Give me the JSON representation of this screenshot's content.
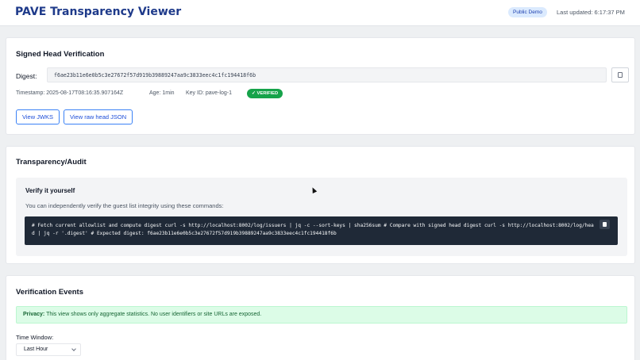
{
  "header": {
    "title": "PAVE Transparency Viewer",
    "badge": "Public Demo",
    "last_updated": "Last updated: 6:17:37 PM"
  },
  "signed_head": {
    "title": "Signed Head Verification",
    "digest_label": "Digest:",
    "digest_value": "f6ae23b11e6e0b5c3e27672f57d919b39889247aa9c3833eec4c1fc194418f6b",
    "timestamp": "Timestamp: 2025-08-17T08:16:35.907164Z",
    "age": "Age: 1min",
    "key_id": "Key ID: pave-log-1",
    "verified_badge": "✓ VERIFIED",
    "view_jwks_label": "View JWKS",
    "view_raw_label": "View raw head JSON",
    "copy_icon": "copy-icon"
  },
  "transparency": {
    "title": "Transparency/Audit",
    "verify_title": "Verify it yourself",
    "verify_desc": "You can independently verify the guest list integrity using these commands:",
    "code": "# Fetch current allowlist and compute digest curl -s http://localhost:8002/log/issuers | jq -c --sort-keys | sha256sum # Compare with signed head digest curl -s http://localhost:8002/log/head | jq -r '.digest' # Expected digest: f6ae23b11e6e0b5c3e27672f57d919b39889247aa9c3833eec4c1fc194418f6b"
  },
  "events": {
    "title": "Verification Events",
    "privacy_label": "Privacy:",
    "privacy_text": "This view shows only aggregate statistics. No user identifiers or site URLs are exposed.",
    "time_window_label": "Time Window:",
    "time_window_value": "Last Hour"
  },
  "colors": {
    "accent": "#1e3a8a",
    "verified": "#16a34a",
    "privacy_bg": "#dcfce7",
    "code_bg": "#1f2937"
  }
}
